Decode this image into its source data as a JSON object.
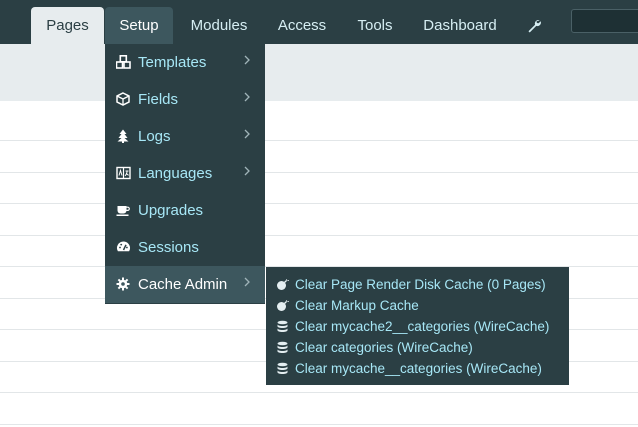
{
  "nav": {
    "tabs": [
      "Pages",
      "Setup",
      "Modules",
      "Access",
      "Tools",
      "Dashboard"
    ],
    "settings_icon": "wrench-icon",
    "search_placeholder": ""
  },
  "setup_menu": {
    "items": [
      {
        "label": "Templates",
        "icon": "cubes-icon",
        "has_submenu": true
      },
      {
        "label": "Fields",
        "icon": "cube-icon",
        "has_submenu": true
      },
      {
        "label": "Logs",
        "icon": "tree-icon",
        "has_submenu": true
      },
      {
        "label": "Languages",
        "icon": "language-icon",
        "has_submenu": true
      },
      {
        "label": "Upgrades",
        "icon": "coffee-icon",
        "has_submenu": false
      },
      {
        "label": "Sessions",
        "icon": "dashboard-icon",
        "has_submenu": false
      },
      {
        "label": "Cache Admin",
        "icon": "gear-icon",
        "has_submenu": true,
        "active": true
      }
    ]
  },
  "cache_submenu": {
    "items": [
      {
        "label": "Clear Page Render Disk Cache (0 Pages)",
        "icon": "bomb-icon"
      },
      {
        "label": "Clear Markup Cache",
        "icon": "bomb-icon"
      },
      {
        "label": "Clear mycache2__categories (WireCache)",
        "icon": "database-icon"
      },
      {
        "label": "Clear categories (WireCache)",
        "icon": "database-icon"
      },
      {
        "label": "Clear mycache__categories (WireCache)",
        "icon": "database-icon"
      }
    ]
  },
  "colors": {
    "nav_bg": "#2b3f44",
    "active_bg": "#3d575e",
    "link": "#a7e7f6",
    "band": "#e7ecee"
  }
}
